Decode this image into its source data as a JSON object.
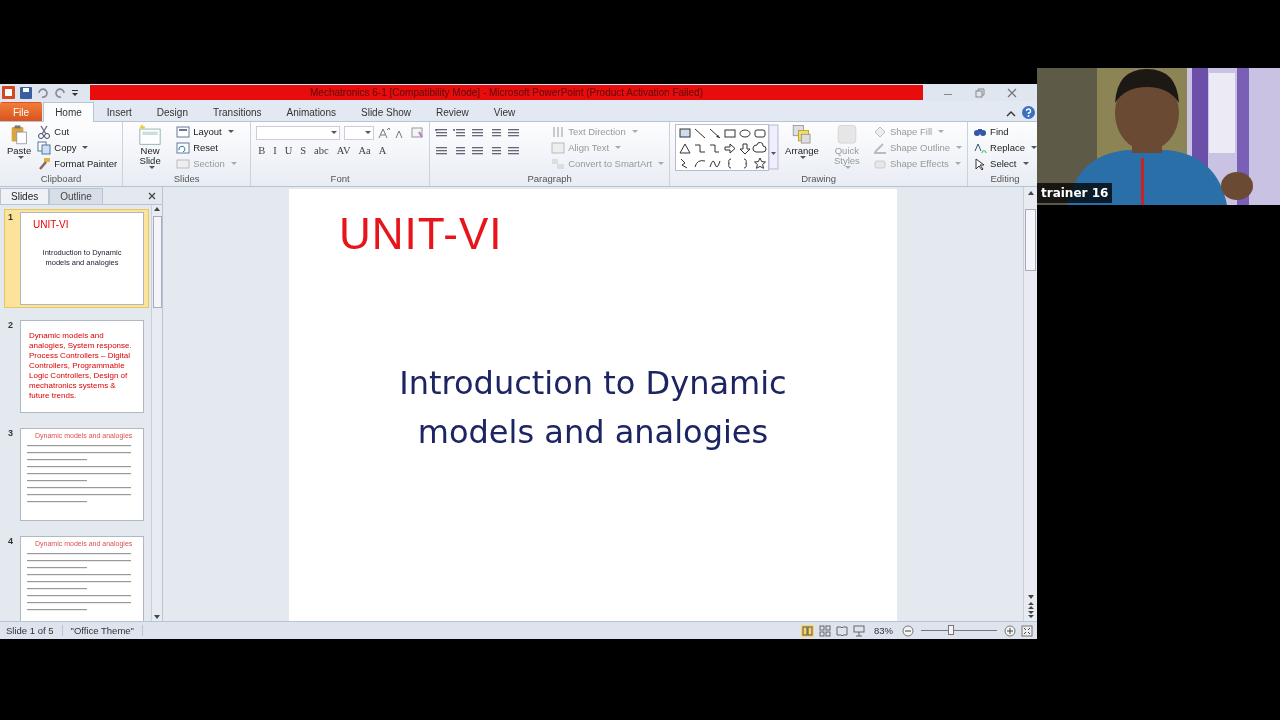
{
  "window": {
    "title": "Mechatronics 6-1 [Compatibility Mode]  -  Microsoft PowerPoint (Product Activation Failed)"
  },
  "ribbon_tabs": [
    {
      "label": "File",
      "kind": "file",
      "selected": false
    },
    {
      "label": "Home",
      "kind": "tab",
      "selected": true
    },
    {
      "label": "Insert",
      "kind": "tab",
      "selected": false
    },
    {
      "label": "Design",
      "kind": "tab",
      "selected": false
    },
    {
      "label": "Transitions",
      "kind": "tab",
      "selected": false
    },
    {
      "label": "Animations",
      "kind": "tab",
      "selected": false
    },
    {
      "label": "Slide Show",
      "kind": "tab",
      "selected": false
    },
    {
      "label": "Review",
      "kind": "tab",
      "selected": false
    },
    {
      "label": "View",
      "kind": "tab",
      "selected": false
    }
  ],
  "ribbon_groups": [
    {
      "label": "Clipboard",
      "kind": "commands",
      "items": [
        {
          "kind": "large",
          "label": "Paste",
          "dropdown": true,
          "disabled": false
        },
        {
          "kind": "small",
          "label": "Cut",
          "dropdown": false,
          "disabled": false
        },
        {
          "kind": "small",
          "label": "Copy",
          "dropdown": true,
          "disabled": false
        },
        {
          "kind": "small",
          "label": "Format Painter",
          "dropdown": false,
          "disabled": false
        }
      ]
    },
    {
      "label": "Slides",
      "kind": "commands",
      "items": [
        {
          "kind": "large",
          "label": "New Slide",
          "dropdown": true,
          "disabled": false
        },
        {
          "kind": "small",
          "label": "Layout",
          "dropdown": true,
          "disabled": false
        },
        {
          "kind": "small",
          "label": "Reset",
          "dropdown": false,
          "disabled": false
        },
        {
          "kind": "small",
          "label": "Section",
          "dropdown": true,
          "disabled": true
        }
      ]
    },
    {
      "label": "Font",
      "kind": "font",
      "buttons": [
        "B",
        "I",
        "U",
        "S",
        "abc",
        "AV",
        "Aa",
        "A"
      ]
    },
    {
      "label": "Paragraph",
      "kind": "paragraph",
      "items": [
        {
          "kind": "small",
          "label": "Text Direction",
          "dropdown": true,
          "disabled": true
        },
        {
          "kind": "small",
          "label": "Align Text",
          "dropdown": true,
          "disabled": true
        },
        {
          "kind": "small",
          "label": "Convert to SmartArt",
          "dropdown": true,
          "disabled": true
        }
      ]
    },
    {
      "label": "Drawing",
      "kind": "drawing",
      "items": [
        {
          "kind": "large",
          "label": "Arrange",
          "dropdown": true,
          "disabled": false
        },
        {
          "kind": "large",
          "label": "Quick Styles",
          "dropdown": true,
          "disabled": true
        },
        {
          "kind": "small",
          "label": "Shape Fill",
          "dropdown": true,
          "disabled": true
        },
        {
          "kind": "small",
          "label": "Shape Outline",
          "dropdown": true,
          "disabled": true
        },
        {
          "kind": "small",
          "label": "Shape Effects",
          "dropdown": true,
          "disabled": true
        }
      ]
    },
    {
      "label": "Editing",
      "kind": "commands",
      "items": [
        {
          "kind": "small",
          "label": "Find",
          "dropdown": false,
          "disabled": false
        },
        {
          "kind": "small",
          "label": "Replace",
          "dropdown": true,
          "disabled": false
        },
        {
          "kind": "small",
          "label": "Select",
          "dropdown": true,
          "disabled": false
        }
      ]
    }
  ],
  "pane_tabs": [
    {
      "label": "Slides",
      "selected": true
    },
    {
      "label": "Outline",
      "selected": false
    }
  ],
  "slides": [
    {
      "number": "1",
      "kind": "title",
      "selected": true,
      "title": "UNIT-VI",
      "body": "Introduction to Dynamic models and analogies"
    },
    {
      "number": "2",
      "kind": "text",
      "selected": false,
      "body": "Dynamic models  and analogies, System response. Process Controllers – Digital Controllers, Programmable Logic Controllers, Design of mechatronics systems & future trends."
    },
    {
      "number": "3",
      "kind": "content",
      "selected": false,
      "title": "Dynamic models and analogies"
    },
    {
      "number": "4",
      "kind": "content",
      "selected": false,
      "title": "Dynamic models and analogies"
    }
  ],
  "current_slide": {
    "title": "UNIT-VI",
    "body": "Introduction to Dynamic models and analogies"
  },
  "status_bar": {
    "slide": "Slide 1 of 5",
    "theme": "\"Office Theme\"",
    "zoom": "83%",
    "zoom_level": {
      "level": 0.4
    }
  },
  "video": {
    "kind": "picture",
    "name": "trainer 16"
  }
}
